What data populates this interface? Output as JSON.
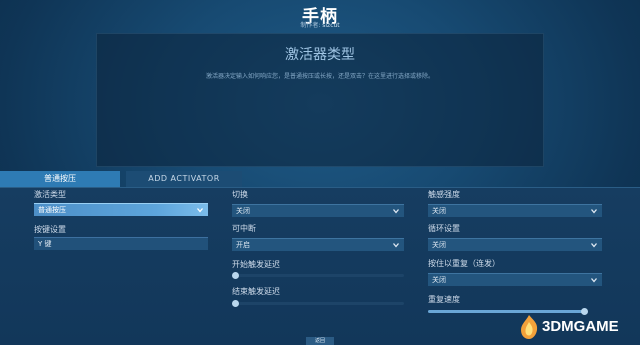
{
  "header": {
    "title": "手柄",
    "author_prefix": "制作者:",
    "author_name": "sizcut"
  },
  "panel": {
    "title": "激活器类型",
    "description": "激活器决定输入如何响应您，是普通按压或长按，还是双击？在这里进行选择或移除。"
  },
  "tabs": [
    {
      "label": "普通按压",
      "active": true
    },
    {
      "label": "ADD ACTIVATOR",
      "active": false
    }
  ],
  "settings": {
    "activation_type": {
      "label": "激活类型",
      "value": "普通按压"
    },
    "key_binding": {
      "label": "按键设置",
      "value": "Y 键"
    },
    "toggle": {
      "label": "切换",
      "value": "关闭"
    },
    "interruptible": {
      "label": "可中断",
      "value": "开启"
    },
    "start_delay": {
      "label": "开始触发延迟",
      "level": 0.0
    },
    "end_delay": {
      "label": "结束触发延迟",
      "level": 0.0
    },
    "haptic_intensity": {
      "label": "触感强度",
      "value": "关闭"
    },
    "cycle": {
      "label": "循环设置",
      "value": "关闭"
    },
    "hold_repeat": {
      "label": "按住以重复（连发）",
      "value": "关闭"
    },
    "repeat_rate": {
      "label": "重复速度",
      "level": 0.98
    }
  },
  "bottom_button": {
    "label": "返回"
  },
  "watermark": {
    "text": "3DMGAME"
  },
  "icons": {
    "caret": "chevron-down-icon",
    "logo": "3dm-logo-icon"
  },
  "colors": {
    "accent": "#2e7bb4",
    "active_dropdown": "#5da5dc",
    "background": "#174a72"
  }
}
